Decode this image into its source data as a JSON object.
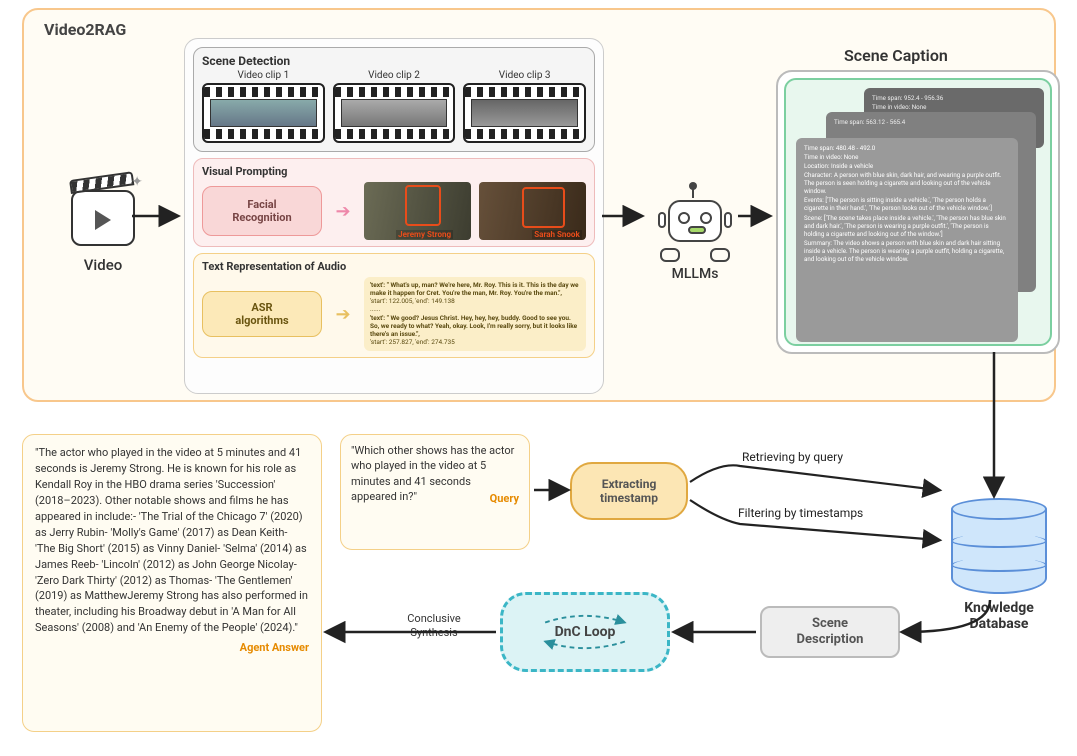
{
  "top": {
    "panel_title": "Video2RAG",
    "video_label": "Video",
    "scene_detection": {
      "title": "Scene Detection",
      "clips": [
        "Video clip 1",
        "Video clip 2",
        "Video clip 3"
      ]
    },
    "visual_prompting": {
      "title": "Visual Prompting",
      "facial_box": "Facial\nRecognition",
      "face1_name": "Jeremy Strong",
      "face2_name": "Sarah Snook"
    },
    "audio": {
      "title": "Text Representation of Audio",
      "asr_box": "ASR\nalgorithms",
      "t1_text": "'text': \" What's up, man? We're here, Mr. Roy. This is it. This is the day we make it happen for Cret. You're the man, Mr. Roy. You're the man.\",",
      "t1_time": "'start': 122.005,  'end': 149.138",
      "t_ellipsis": "......",
      "t2_text": "'text': \" We good? Jesus Christ. Hey, hey, hey, buddy. Good to see you. So, we ready to what? Yeah, okay. Look, I'm really sorry, but it looks like there's an issue.\",",
      "t2_time": "'start': 257.827,  'end': 274.735"
    },
    "mllms_label": "MLLMs",
    "scene_caption": {
      "title": "Scene Caption",
      "card3_l1": "Time span: 952.4 - 956.36",
      "card3_l2": "Time in video: None",
      "card2_l1": "Time span: 563.12 - 565.4",
      "card1": {
        "l1": "Time span: 480.48 - 492.0",
        "l2": "Time in video: None",
        "l3": "Location: Inside a vehicle",
        "l4": "Character: A person with blue skin, dark hair, and wearing a purple outfit. The person is seen holding a cigarette and looking out of the vehicle window.",
        "l5": "Events: ['The person is sitting inside a vehicle.', 'The person holds a cigarette in their hand.', 'The person looks out of the vehicle window.']",
        "l6": "Scene: ['The scene takes place inside a vehicle.', 'The person has blue skin and dark hair.', 'The person is wearing a purple outfit.', 'The person is holding a cigarette and looking out of the window.']",
        "l7": "Summary: The video shows a person with blue skin and dark hair sitting inside a vehicle. The person is wearing a purple outfit, holding a cigarette, and looking out of the vehicle window."
      }
    }
  },
  "bottom": {
    "answer": "\"The actor who played in the video at 5 minutes and 41 seconds is Jeremy Strong. He is known for his role as Kendall Roy in the HBO drama series 'Succession' (2018–2023). Other notable shows and films he has appeared in include:- 'The Trial of the Chicago 7' (2020) as Jerry Rubin- 'Molly's Game' (2017) as Dean Keith- 'The Big Short' (2015) as Vinny Daniel- 'Selma' (2014) as James Reeb- 'Lincoln' (2012) as John George Nicolay- 'Zero Dark Thirty' (2012) as Thomas- 'The Gentlemen' (2019) as MatthewJeremy Strong has also performed in theater, including his Broadway debut in 'A Man for All Seasons' (2008) and 'An Enemy of the People' (2024).\"",
    "answer_tag": "Agent Answer",
    "query": "\"Which other shows has the actor who played in the video at 5 minutes and 41 seconds appeared in?\"",
    "query_tag": "Query",
    "extract_ts": "Extracting\ntimestamp",
    "retrieve1": "Retrieving by query",
    "retrieve2": "Filtering by timestamps",
    "kdb": "Knowledge\nDatabase",
    "scene_desc": "Scene\nDescription",
    "dnc": "DnC Loop",
    "conc": "Conclusive\nSynthesis"
  }
}
